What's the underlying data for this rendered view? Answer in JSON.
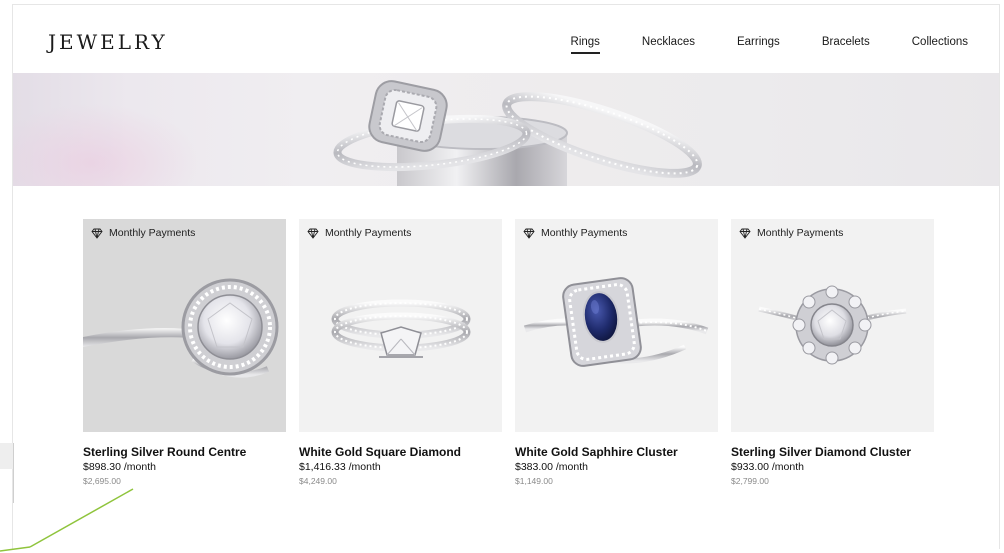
{
  "site": {
    "logo": "JEWELRY"
  },
  "nav": {
    "items": [
      {
        "label": "Rings",
        "active": true
      },
      {
        "label": "Necklaces",
        "active": false
      },
      {
        "label": "Earrings",
        "active": false
      },
      {
        "label": "Bracelets",
        "active": false
      },
      {
        "label": "Collections",
        "active": false
      }
    ]
  },
  "hero": {
    "icon": "rings-photo"
  },
  "products": [
    {
      "badge": "Monthly Payments",
      "title": "Sterling Silver Round Centre",
      "monthly": "$898.30 /month",
      "price": "$2,695.00"
    },
    {
      "badge": "Monthly Payments",
      "title": "White Gold Square Diamond",
      "monthly": "$1,416.33 /month",
      "price": "$4,249.00"
    },
    {
      "badge": "Monthly Payments",
      "title": "White Gold Saphhire Cluster",
      "monthly": "$383.00 /month",
      "price": "$1,149.00"
    },
    {
      "badge": "Monthly Payments",
      "title": "Sterling Silver Diamond Cluster",
      "monthly": "$933.00 /month",
      "price": "$2,799.00"
    }
  ],
  "colors": {
    "accent_line": "#8fc43c",
    "sapphire": "#1e2a6b",
    "text": "#111111",
    "muted": "#8a8a8a"
  }
}
